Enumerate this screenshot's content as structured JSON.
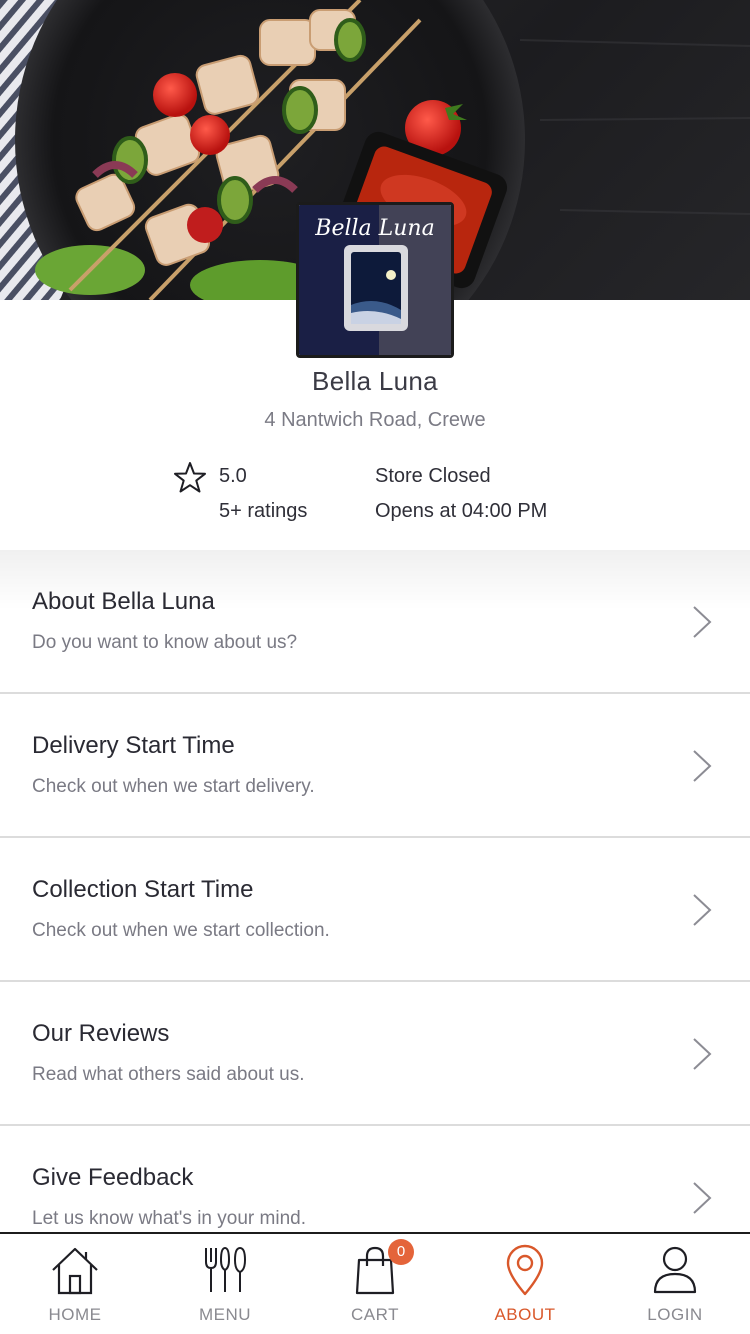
{
  "store": {
    "name": "Bella Luna",
    "address": "4 Nantwich Road, Crewe",
    "rating": "5.0",
    "ratings_count": "5+ ratings",
    "status": "Store Closed",
    "opens": "Opens at 04:00 PM",
    "logo_text": "Bella Luna"
  },
  "menu_items": [
    {
      "title": "About Bella Luna",
      "subtitle": "Do you want to know about us?"
    },
    {
      "title": "Delivery Start Time",
      "subtitle": "Check out when we start delivery."
    },
    {
      "title": "Collection Start Time",
      "subtitle": "Check out when we start collection."
    },
    {
      "title": "Our Reviews",
      "subtitle": "Read what others said about us."
    },
    {
      "title": "Give Feedback",
      "subtitle": "Let us know what's in your mind."
    }
  ],
  "nav": {
    "items": [
      {
        "label": "HOME",
        "icon": "home-icon"
      },
      {
        "label": "MENU",
        "icon": "cutlery-icon"
      },
      {
        "label": "CART",
        "icon": "shopping-bag-icon"
      },
      {
        "label": "ABOUT",
        "icon": "map-pin-icon"
      },
      {
        "label": "LOGIN",
        "icon": "user-icon"
      }
    ],
    "active": "ABOUT",
    "cart_count": "0"
  },
  "colors": {
    "accent": "#d9582b",
    "badge": "#e4643a",
    "text_primary": "#2a2a33",
    "text_secondary": "#7a7a84"
  }
}
